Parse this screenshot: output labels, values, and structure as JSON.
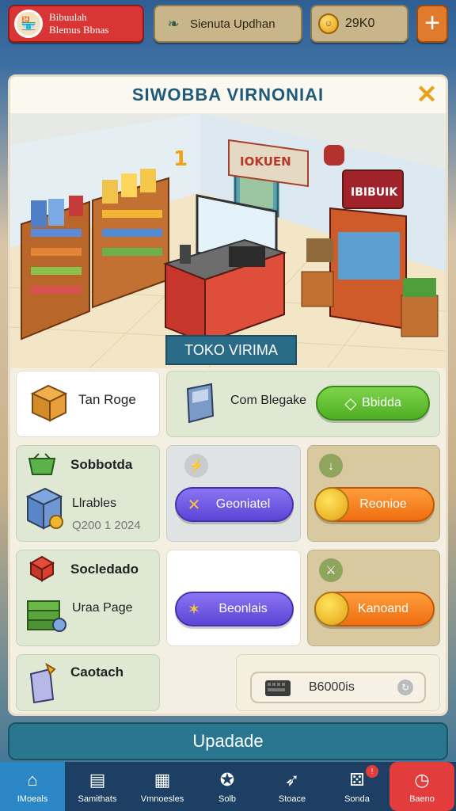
{
  "profile": {
    "line1": "Bibuulah",
    "line2": "Blemus Bbnas"
  },
  "status": {
    "label": "Sienuta Updhan",
    "icon": "leaf-icon"
  },
  "coins": {
    "value": "29K0"
  },
  "panel": {
    "title": "SIWOBBA VIRNONIAI",
    "shop_label": "TOKO VIRIMA",
    "scene_signs": {
      "left_sign": "IOKUEN",
      "stand_sign": "IBIBUIK"
    }
  },
  "rows": {
    "r1": {
      "left_label": "Tan Roge",
      "right_label": "Com Blegake",
      "right_button": "Bbidda"
    },
    "r2": {
      "title": "Sobbotda",
      "item": "Llrables",
      "meta": "Q200 1 2024",
      "mid_button": "Geoniatel",
      "right_button": "Reonioe"
    },
    "r3": {
      "title": "Socledado",
      "item": "Uraa Page",
      "mid_button": "Beonlais",
      "right_button": "Kanoand"
    },
    "r4": {
      "title": "Caotach",
      "field": "B6000is"
    }
  },
  "update_button": "Upadade",
  "nav": [
    {
      "label": "IMoeals",
      "icon": "home-icon"
    },
    {
      "label": "Samithats",
      "icon": "document-icon"
    },
    {
      "label": "Vmnoesles",
      "icon": "chart-icon"
    },
    {
      "label": "Solb",
      "icon": "star-icon"
    },
    {
      "label": "Stoace",
      "icon": "rocket-icon"
    },
    {
      "label": "Sonda",
      "icon": "dice-icon"
    },
    {
      "label": "Baeno",
      "icon": "clock-icon"
    }
  ],
  "colors": {
    "accent_blue": "#2a6b87",
    "green_button": "#4fae24",
    "purple_button": "#5b45d6",
    "orange_button": "#ef6e10",
    "red": "#e33c3c"
  }
}
